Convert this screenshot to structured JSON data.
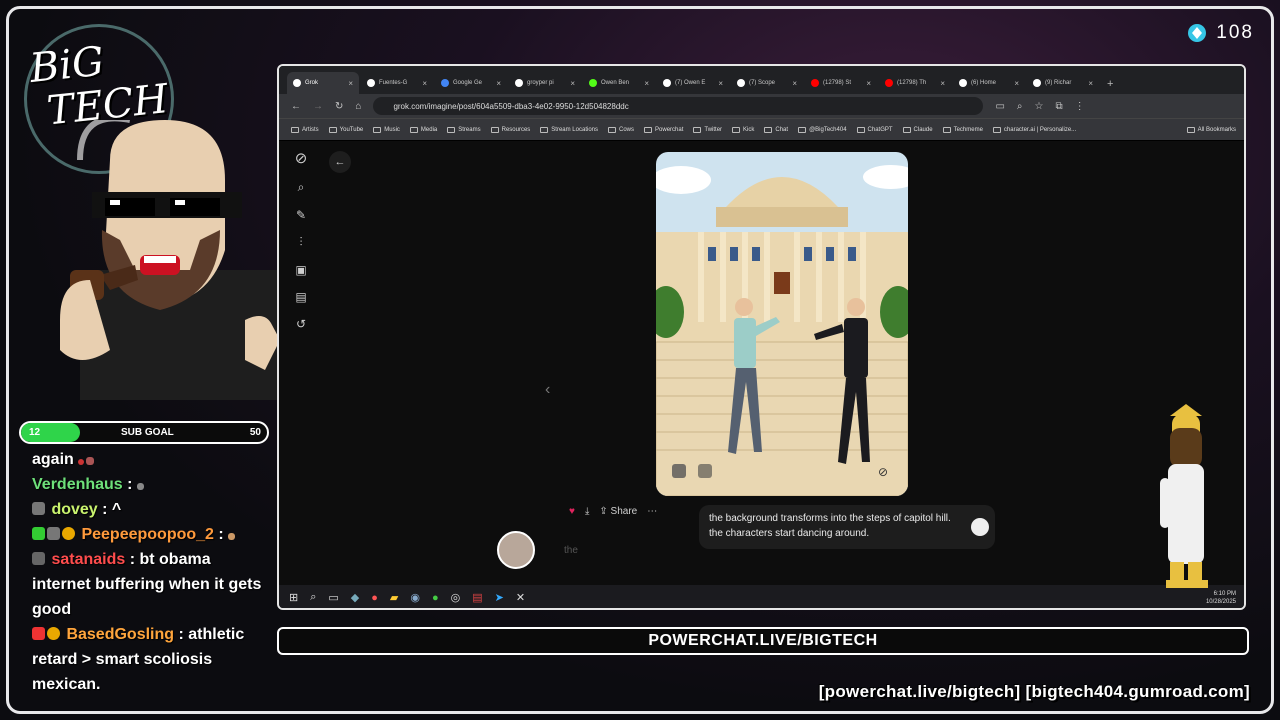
{
  "overlay": {
    "viewer_count": "108",
    "logo_text": "BIG TECH",
    "sub_goal": {
      "current": "12",
      "label": "SUB GOAL",
      "target": "50",
      "progress": 0.24
    },
    "banner": "POWERCHAT.LIVE/BIGTECH",
    "footer_links": "[powerchat.live/bigtech] [bigtech404.gumroad.com]"
  },
  "chat": [
    {
      "user": "",
      "text": "again",
      "suffix": ""
    },
    {
      "user": "Verdenhaus",
      "text": ""
    },
    {
      "user": "dovey",
      "text": "^"
    },
    {
      "user": "Peepeepoopoo_2",
      "text": ""
    },
    {
      "user": "satanaids",
      "text": "bt obama internet buffering when it gets good"
    },
    {
      "user": "BasedGosling",
      "text": "athletic retard > smart scoliosis mexican."
    }
  ],
  "browser": {
    "tabs": [
      {
        "label": "Grok",
        "color": "#ffffff"
      },
      {
        "label": "Fuentes-G",
        "color": "#ffffff"
      },
      {
        "label": "Google Ge",
        "color": "#4285f4"
      },
      {
        "label": "groyper pi",
        "color": "#ffffff"
      },
      {
        "label": "Owen Ben",
        "color": "#53fc18"
      },
      {
        "label": "(7) Owen E",
        "color": "#ffffff"
      },
      {
        "label": "(7) Scope",
        "color": "#ffffff"
      },
      {
        "label": "(12798) St",
        "color": "#ff0000"
      },
      {
        "label": "(12798) Th",
        "color": "#ff0000"
      },
      {
        "label": "(6) Home",
        "color": "#ffffff"
      },
      {
        "label": "(9) Richar",
        "color": "#ffffff"
      }
    ],
    "url": "grok.com/imagine/post/604a5509-dba3-4e02-9950-12d504828ddc",
    "bookmarks": [
      "Artists",
      "YouTube",
      "Music",
      "Media",
      "Streams",
      "Resources",
      "Stream Locations",
      "Cows",
      "Powerchat",
      "Twitter",
      "Kick",
      "Chat",
      "@BigTech404",
      "ChatGPT",
      "Claude",
      "Techmeme",
      "character.ai | Personalize...",
      "All Bookmarks"
    ],
    "share_label": "Share",
    "prompt_text": "the background transforms into the steps of capitol hill. the characters start dancing around.",
    "input_placeholder": "the",
    "clock_time": "6:10 PM",
    "clock_date": "10/28/2025"
  }
}
